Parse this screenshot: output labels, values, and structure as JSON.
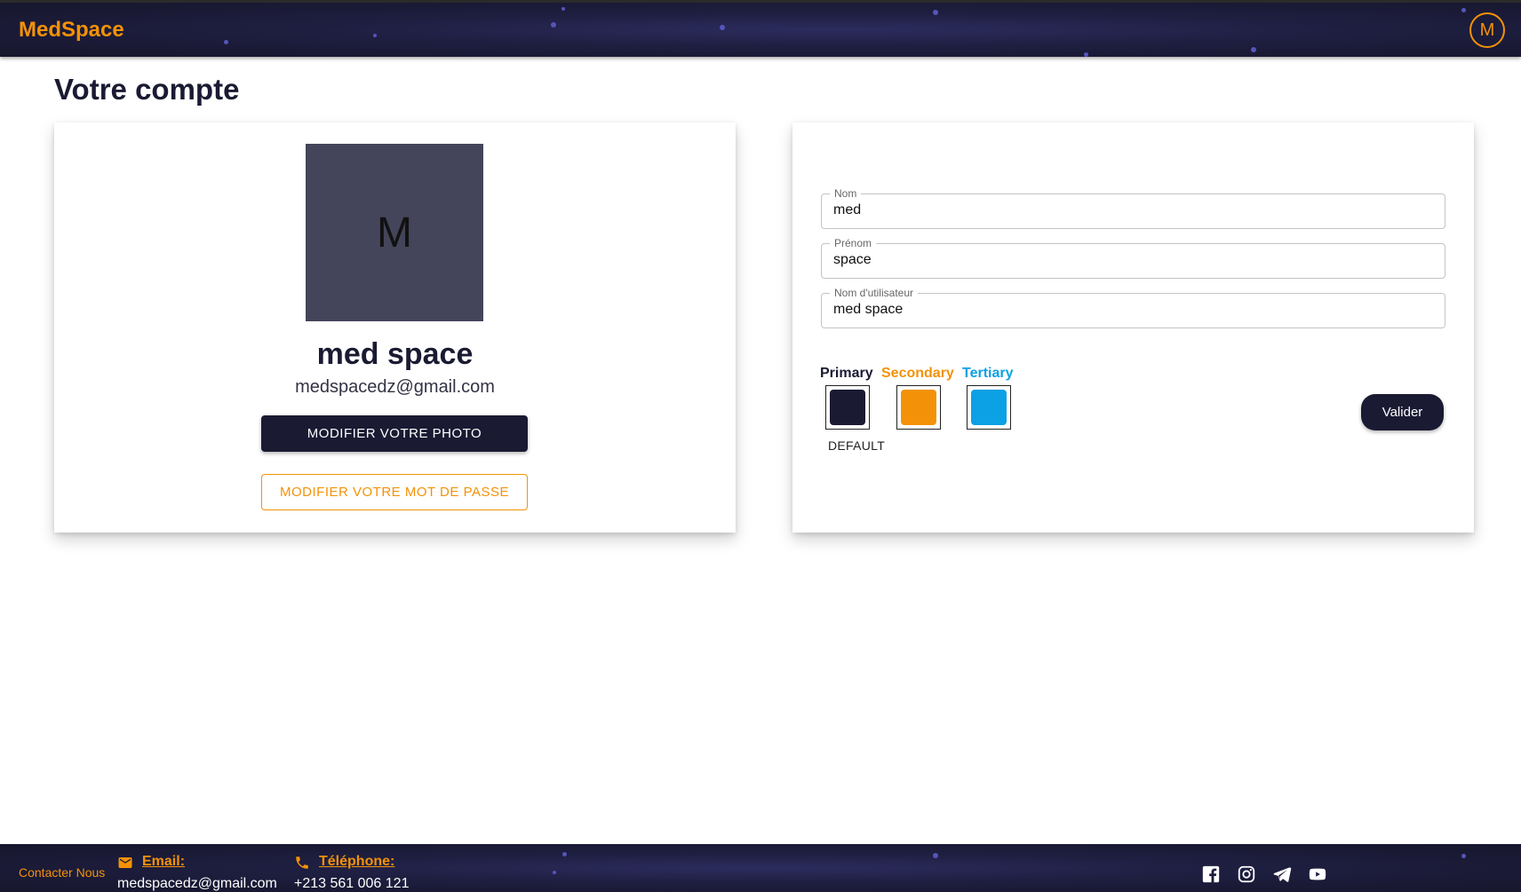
{
  "header": {
    "brand": "MedSpace",
    "avatar_initial": "M"
  },
  "page": {
    "title": "Votre compte"
  },
  "profile": {
    "avatar_initial": "M",
    "name": "med space",
    "email": "medspacedz@gmail.com",
    "change_photo_label": "MODIFIER VOTRE PHOTO",
    "change_password_label": "MODIFIER VOTRE MOT DE PASSE"
  },
  "form": {
    "nom": {
      "label": "Nom",
      "value": "med"
    },
    "prenom": {
      "label": "Prénom",
      "value": "space"
    },
    "username": {
      "label": "Nom d'utilisateur",
      "value": "med space"
    }
  },
  "colors": {
    "primary": {
      "label": "Primary",
      "hex": "#1a1a33"
    },
    "secondary": {
      "label": "Secondary",
      "hex": "#f39208"
    },
    "tertiary": {
      "label": "Tertiary",
      "hex": "#0ca0e4"
    },
    "default_label": "DEFAULT",
    "submit_label": "Valider"
  },
  "footer": {
    "contact_label": "Contacter Nous",
    "email_label": "Email:",
    "email_value": "medspacedz@gmail.com",
    "phone_label": "Téléphone:",
    "phone_value": "+213 561 006 121"
  },
  "icons": {
    "email": "email-icon",
    "phone": "phone-icon",
    "social": [
      "facebook-icon",
      "instagram-icon",
      "telegram-icon",
      "youtube-icon"
    ]
  }
}
